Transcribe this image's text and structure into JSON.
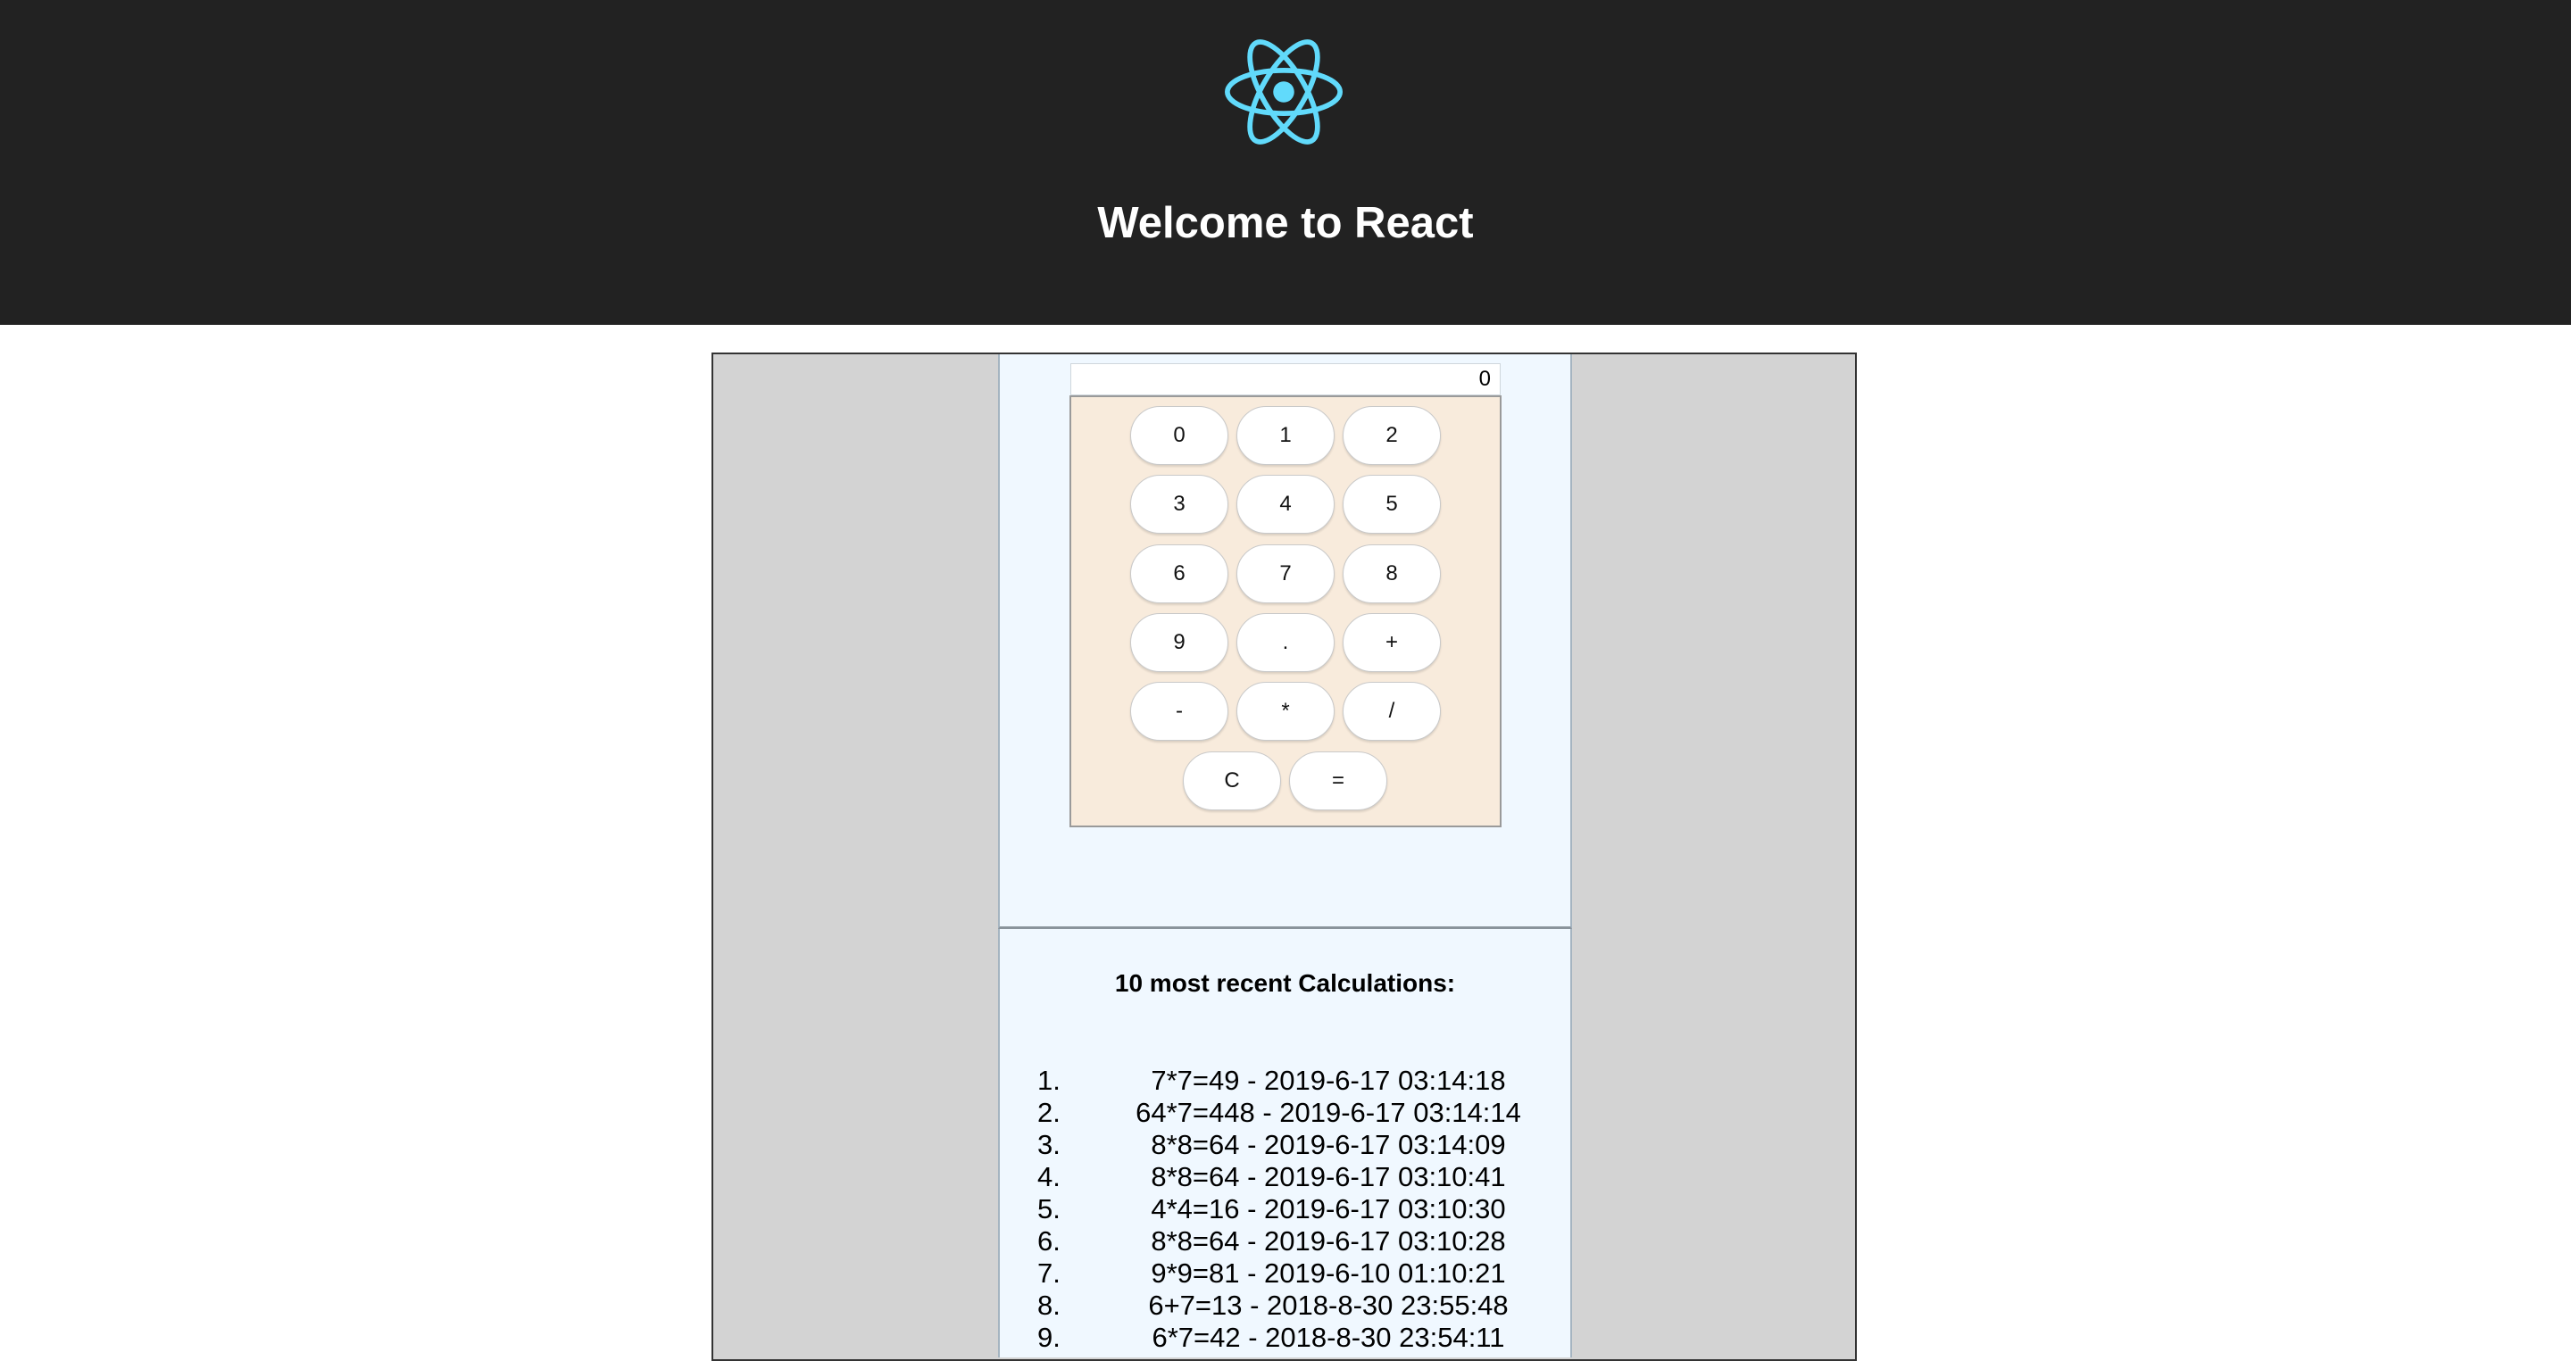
{
  "header": {
    "title": "Welcome to React",
    "logo_color": "#61dafb",
    "background": "#222222"
  },
  "calculator": {
    "display_value": "0",
    "keys": [
      "0",
      "1",
      "2",
      "3",
      "4",
      "5",
      "6",
      "7",
      "8",
      "9",
      ".",
      "+",
      "-",
      "*",
      "/",
      "C",
      "="
    ]
  },
  "history": {
    "heading": "10 most recent Calculations:",
    "items": [
      {
        "number": "1.",
        "text": "7*7=49 - 2019-6-17 03:14:18"
      },
      {
        "number": "2.",
        "text": "64*7=448 - 2019-6-17 03:14:14"
      },
      {
        "number": "3.",
        "text": "8*8=64 - 2019-6-17 03:14:09"
      },
      {
        "number": "4.",
        "text": "8*8=64 - 2019-6-17 03:10:41"
      },
      {
        "number": "5.",
        "text": "4*4=16 - 2019-6-17 03:10:30"
      },
      {
        "number": "6.",
        "text": "8*8=64 - 2019-6-17 03:10:28"
      },
      {
        "number": "7.",
        "text": "9*9=81 - 2019-6-10 01:10:21"
      },
      {
        "number": "8.",
        "text": "6+7=13 - 2018-8-30 23:55:48"
      },
      {
        "number": "9.",
        "text": "6*7=42 - 2018-8-30 23:54:11"
      }
    ]
  }
}
